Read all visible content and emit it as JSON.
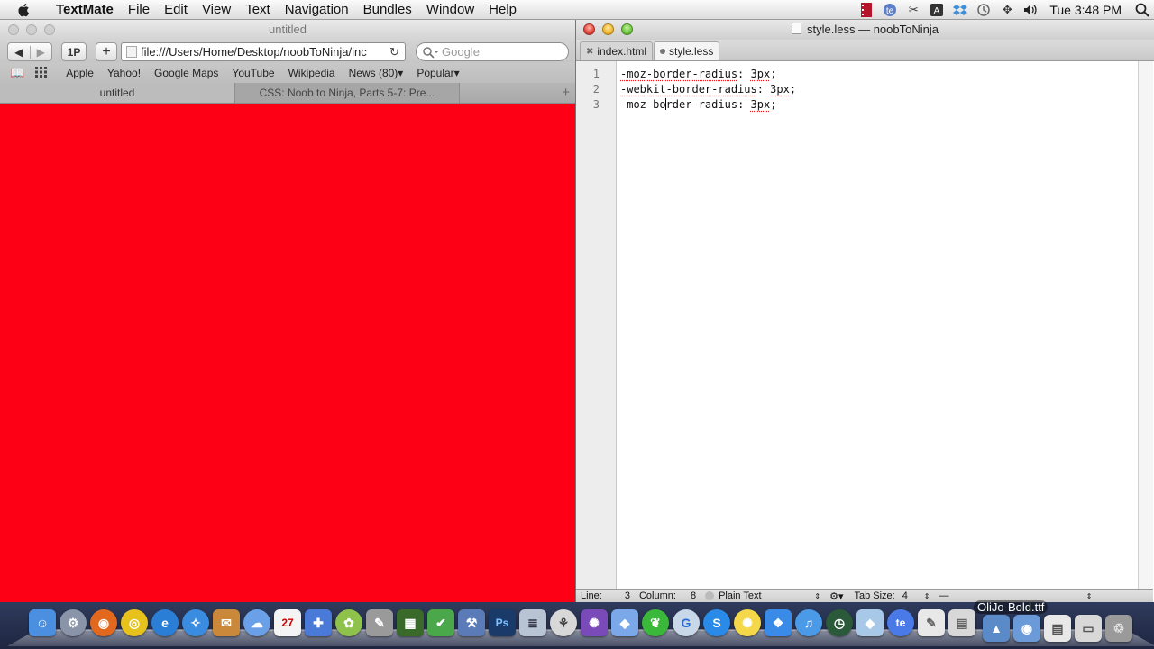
{
  "menubar": {
    "app_name": "TextMate",
    "menus": [
      "File",
      "Edit",
      "View",
      "Text",
      "Navigation",
      "Bundles",
      "Window",
      "Help"
    ],
    "clock": "Tue 3:48 PM"
  },
  "safari": {
    "title": "untitled",
    "address": "file:///Users/Home/Desktop/noobToNinja/inc",
    "search_placeholder": "Google",
    "onep_label": "1P",
    "bookmarks": [
      "Apple",
      "Yahoo!",
      "Google Maps",
      "YouTube",
      "Wikipedia",
      "News (80)▾",
      "Popular▾"
    ],
    "tabs": [
      "untitled",
      "CSS: Noob to Ninja, Parts 5-7: Pre..."
    ],
    "page_color": "#fe0016"
  },
  "textmate": {
    "title": "style.less — noobToNinja",
    "tabs": [
      "index.html",
      "style.less"
    ],
    "line_numbers": [
      "1",
      "2",
      "3"
    ],
    "lines": [
      {
        "prop": "-moz-border-radius",
        "value": "3px"
      },
      {
        "prop": "-webkit-border-radius",
        "value": "3px"
      },
      {
        "prop_before_caret": "-moz-bo",
        "prop_after_caret": "rder-radius",
        "value": "3px"
      }
    ],
    "status": {
      "line_label": "Line:",
      "line_value": "3",
      "column_label": "Column:",
      "column_value": "8",
      "language": "Plain Text",
      "tab_size_label": "Tab Size:",
      "tab_size_value": "4",
      "symbol": "—"
    }
  },
  "dock": {
    "hover_label": "OliJo-Bold.ttf"
  }
}
